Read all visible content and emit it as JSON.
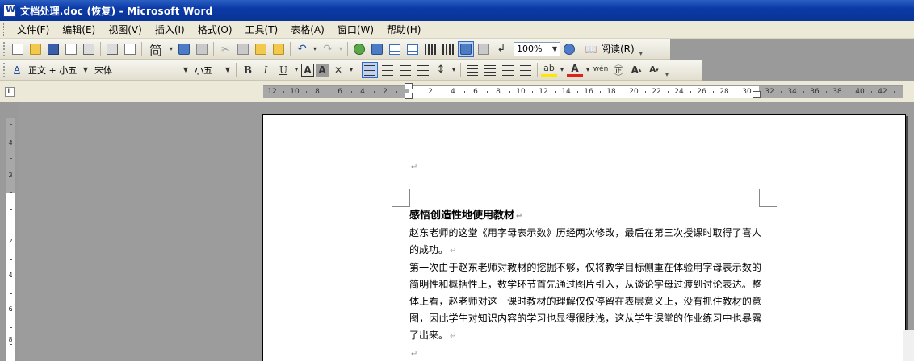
{
  "window": {
    "title": "文档处理.doc (恢复) - Microsoft Word"
  },
  "menubar": {
    "items": [
      "文件(F)",
      "编辑(E)",
      "视图(V)",
      "插入(I)",
      "格式(O)",
      "工具(T)",
      "表格(A)",
      "窗口(W)",
      "帮助(H)"
    ]
  },
  "toolbar_standard": {
    "zoom": "100%",
    "read_label": "阅读(R)",
    "simplified_label": "简"
  },
  "toolbar_format": {
    "style": "正文 + 小五",
    "font": "宋体",
    "size": "小五",
    "bold": "B",
    "italic": "I",
    "underline": "U",
    "char_border": "A",
    "char_shade": "A",
    "font_color": "A",
    "grow": "A",
    "shrink": "A",
    "phonetic": "wén"
  },
  "ruler": {
    "ticks": [
      "12",
      "10",
      "8",
      "6",
      "4",
      "2",
      "2",
      "4",
      "6",
      "8",
      "10",
      "12",
      "14",
      "16",
      "18",
      "20",
      "22",
      "24",
      "26",
      "28",
      "30",
      "32",
      "34",
      "36",
      "38",
      "40",
      "42"
    ],
    "vticks": [
      "4",
      "2",
      "2",
      "4",
      "6",
      "8"
    ],
    "tab_selector": "L"
  },
  "document": {
    "heading": "感悟创造性地使用教材",
    "paragraphs": [
      "赵东老师的这堂《用字母表示数》历经两次修改，最后在第三次授课时取得了喜人的成功。",
      "第一次由于赵东老师对教材的挖掘不够，仅将教学目标侧重在体验用字母表示数的简明性和概括性上，数学环节首先通过图片引入，从谈论字母过渡到讨论表达。整体上看，赵老师对这一课时教材的理解仅仅停留在表层意义上，没有抓住教材的意图，因此学生对知识内容的学习也显得很肤浅，这从学生课堂的作业练习中也暴露了出来。"
    ],
    "para_mark": "↵"
  }
}
